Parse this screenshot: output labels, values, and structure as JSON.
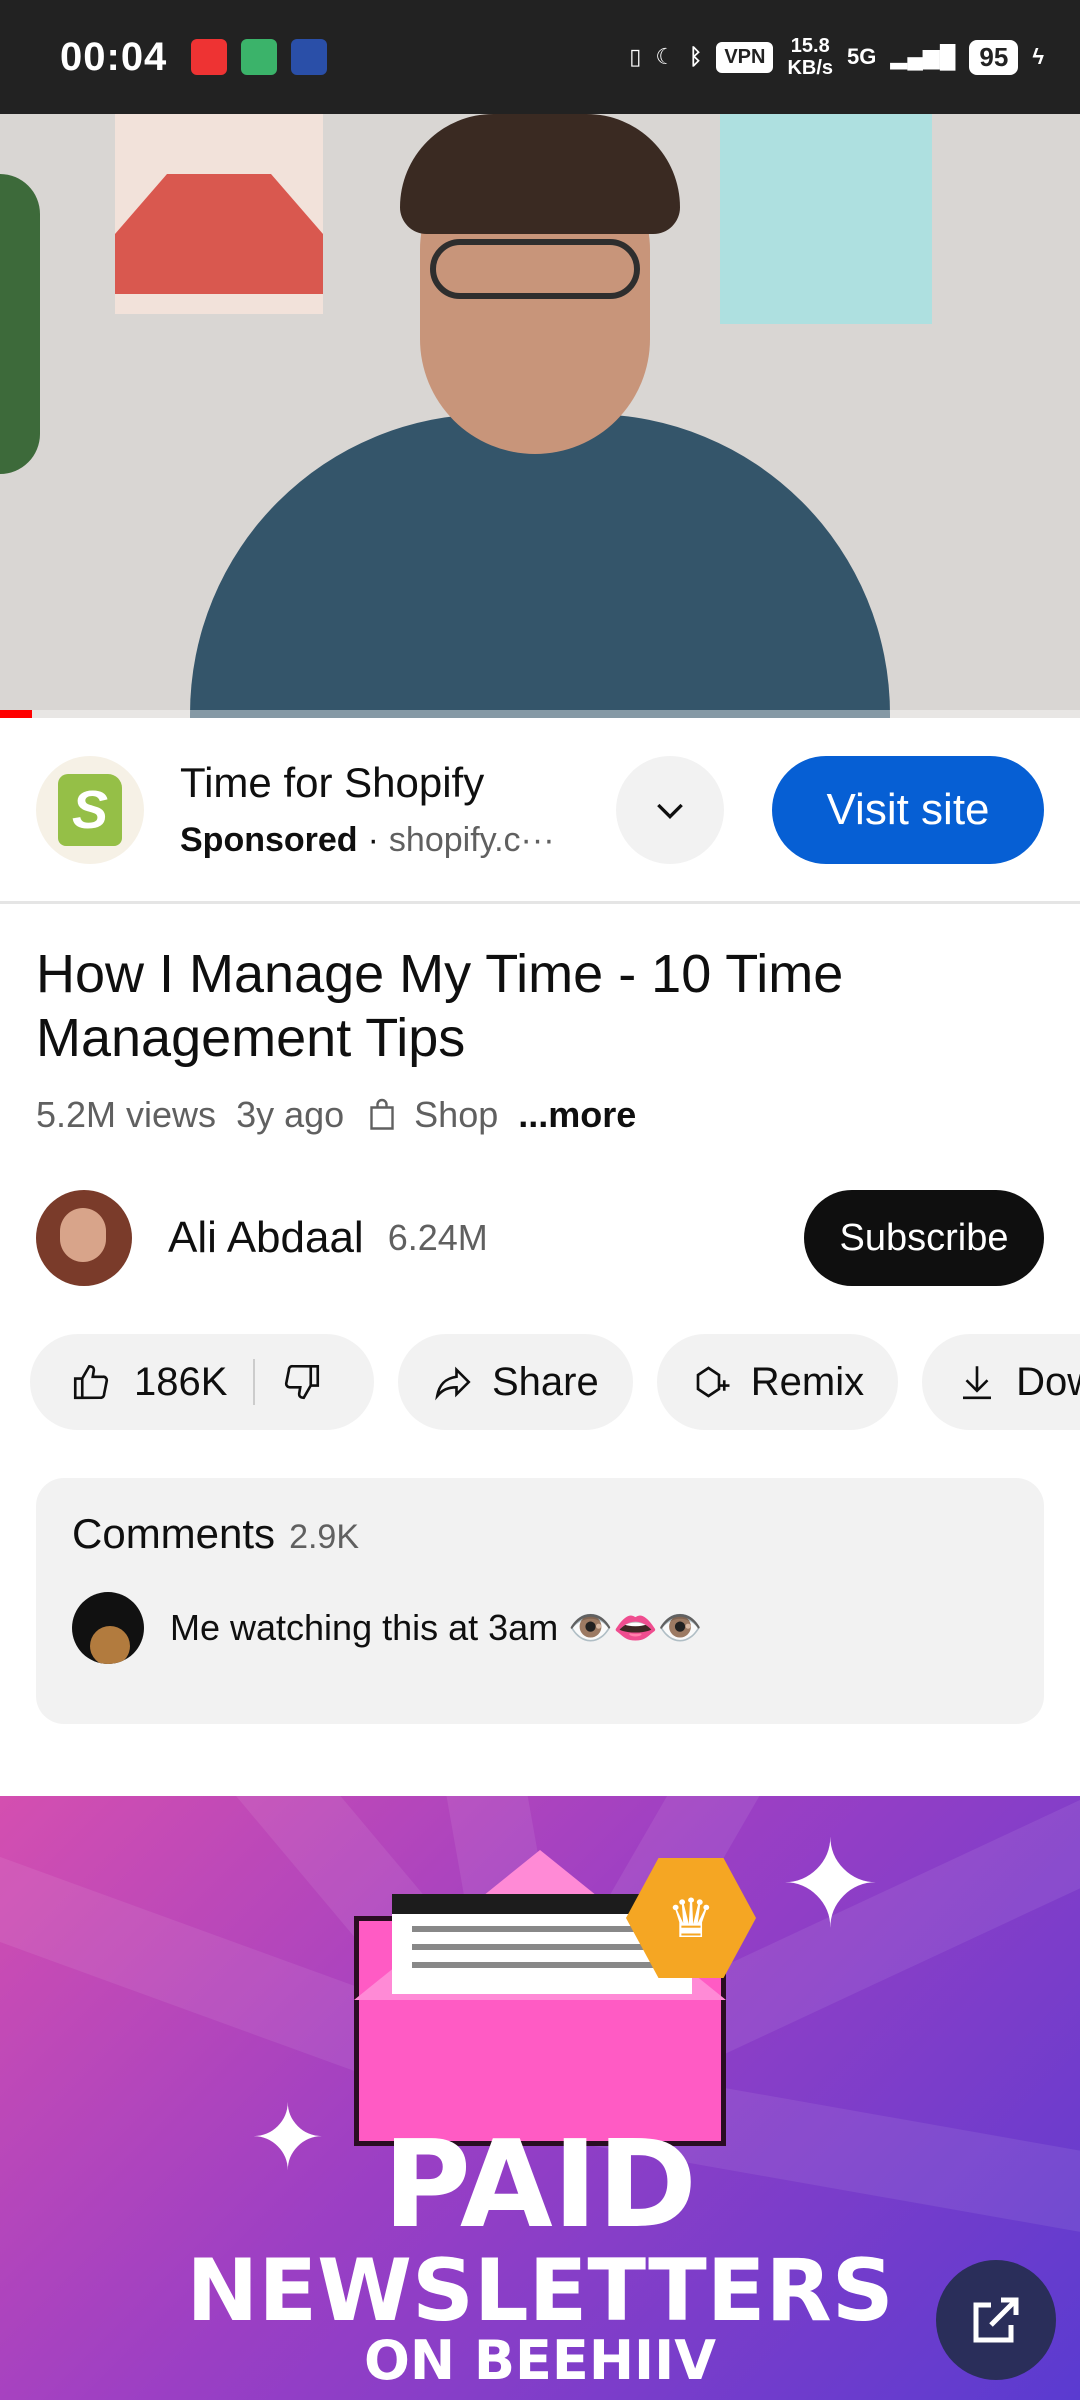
{
  "status_bar": {
    "time": "00:04",
    "vpn": "VPN",
    "speed_value": "15.8",
    "speed_unit": "KB/s",
    "network": "5G",
    "battery": "95"
  },
  "video": {
    "progress_fraction": 0.03
  },
  "ad": {
    "title": "Time for Shopify",
    "sponsored": "Sponsored",
    "separator": "·",
    "domain": "shopify.c···",
    "cta": "Visit site",
    "brand_color": "#95bf47",
    "cta_color": "#065fd4"
  },
  "video_info": {
    "title": "How I Manage My Time - 10 Time Management Tips",
    "views": "5.2M views",
    "age": "3y ago",
    "shop": "Shop",
    "more": "...more"
  },
  "channel": {
    "name": "Ali Abdaal",
    "subscribers": "6.24M",
    "subscribe_label": "Subscribe"
  },
  "actions": {
    "likes": "186K",
    "share": "Share",
    "remix": "Remix",
    "download": "Dow"
  },
  "comments": {
    "label": "Comments",
    "count": "2.9K",
    "top_comment": "Me watching this at 3am 👁️👄👁️"
  },
  "banner": {
    "line1": "PAID",
    "line2": "NEWSLETTERS",
    "line3": "ON BEEHIIV"
  },
  "icons": [
    "like-icon",
    "dislike-icon",
    "share-icon",
    "remix-icon",
    "download-icon",
    "chevron-down-icon",
    "bag-icon",
    "external-link-icon"
  ]
}
